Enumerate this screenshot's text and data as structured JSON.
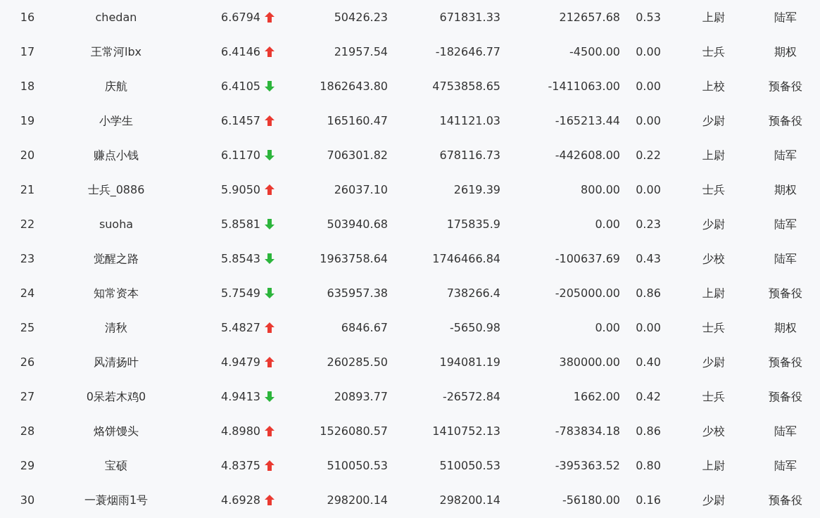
{
  "table": {
    "rows": [
      {
        "cells": [
          "16",
          "chedan",
          "6.6794",
          "50426.23",
          "671831.33",
          "212657.68",
          "0.53",
          "上尉",
          "陆军"
        ],
        "kind": "up"
      },
      {
        "cells": [
          "17",
          "王常河lbx",
          "6.4146",
          "21957.54",
          "-182646.77",
          "-4500.00",
          "0.00",
          "士兵",
          "期权"
        ],
        "kind": "up"
      },
      {
        "cells": [
          "18",
          "庆航",
          "6.4105",
          "1862643.80",
          "4753858.65",
          "-1411063.00",
          "0.00",
          "上校",
          "预备役"
        ],
        "kind": "down"
      },
      {
        "cells": [
          "19",
          "小学生",
          "6.1457",
          "165160.47",
          "141121.03",
          "-165213.44",
          "0.00",
          "少尉",
          "预备役"
        ],
        "kind": "up"
      },
      {
        "cells": [
          "20",
          "赚点小钱",
          "6.1170",
          "706301.82",
          "678116.73",
          "-442608.00",
          "0.22",
          "上尉",
          "陆军"
        ],
        "kind": "down"
      },
      {
        "cells": [
          "21",
          "士兵_0886",
          "5.9050",
          "26037.10",
          "2619.39",
          "800.00",
          "0.00",
          "士兵",
          "期权"
        ],
        "kind": "up"
      },
      {
        "cells": [
          "22",
          "suoha",
          "5.8581",
          "503940.68",
          "175835.9",
          "0.00",
          "0.23",
          "少尉",
          "陆军"
        ],
        "kind": "down"
      },
      {
        "cells": [
          "23",
          "觉醒之路",
          "5.8543",
          "1963758.64",
          "1746466.84",
          "-100637.69",
          "0.43",
          "少校",
          "陆军"
        ],
        "kind": "down"
      },
      {
        "cells": [
          "24",
          "知常资本",
          "5.7549",
          "635957.38",
          "738266.4",
          "-205000.00",
          "0.86",
          "上尉",
          "预备役"
        ],
        "kind": "down"
      },
      {
        "cells": [
          "25",
          "清秋",
          "5.4827",
          "6846.67",
          "-5650.98",
          "0.00",
          "0.00",
          "士兵",
          "期权"
        ],
        "kind": "up"
      },
      {
        "cells": [
          "26",
          "风清扬叶",
          "4.9479",
          "260285.50",
          "194081.19",
          "380000.00",
          "0.40",
          "少尉",
          "预备役"
        ],
        "kind": "up"
      },
      {
        "cells": [
          "27",
          "0呆若木鸡0",
          "4.9413",
          "20893.77",
          "-26572.84",
          "1662.00",
          "0.42",
          "士兵",
          "预备役"
        ],
        "kind": "down"
      },
      {
        "cells": [
          "28",
          "烙饼馒头",
          "4.8980",
          "1526080.57",
          "1410752.13",
          "-783834.18",
          "0.86",
          "少校",
          "陆军"
        ],
        "kind": "up"
      },
      {
        "cells": [
          "29",
          "宝硕",
          "4.8375",
          "510050.53",
          "510050.53",
          "-395363.52",
          "0.80",
          "上尉",
          "陆军"
        ],
        "kind": "up"
      },
      {
        "cells": [
          "30",
          "一蓑烟雨1号",
          "4.6928",
          "298200.14",
          "298200.14",
          "-56180.00",
          "0.16",
          "少尉",
          "预备役"
        ],
        "kind": "up"
      }
    ]
  }
}
